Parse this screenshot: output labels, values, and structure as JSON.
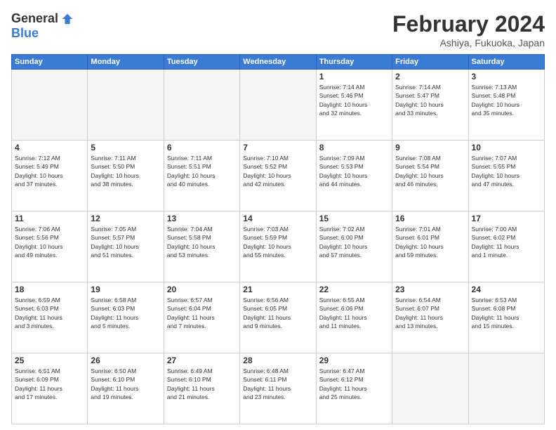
{
  "header": {
    "logo_general": "General",
    "logo_blue": "Blue",
    "month_year": "February 2024",
    "location": "Ashiya, Fukuoka, Japan"
  },
  "weekdays": [
    "Sunday",
    "Monday",
    "Tuesday",
    "Wednesday",
    "Thursday",
    "Friday",
    "Saturday"
  ],
  "weeks": [
    [
      {
        "day": "",
        "info": ""
      },
      {
        "day": "",
        "info": ""
      },
      {
        "day": "",
        "info": ""
      },
      {
        "day": "",
        "info": ""
      },
      {
        "day": "1",
        "info": "Sunrise: 7:14 AM\nSunset: 5:46 PM\nDaylight: 10 hours\nand 32 minutes."
      },
      {
        "day": "2",
        "info": "Sunrise: 7:14 AM\nSunset: 5:47 PM\nDaylight: 10 hours\nand 33 minutes."
      },
      {
        "day": "3",
        "info": "Sunrise: 7:13 AM\nSunset: 5:48 PM\nDaylight: 10 hours\nand 35 minutes."
      }
    ],
    [
      {
        "day": "4",
        "info": "Sunrise: 7:12 AM\nSunset: 5:49 PM\nDaylight: 10 hours\nand 37 minutes."
      },
      {
        "day": "5",
        "info": "Sunrise: 7:11 AM\nSunset: 5:50 PM\nDaylight: 10 hours\nand 38 minutes."
      },
      {
        "day": "6",
        "info": "Sunrise: 7:11 AM\nSunset: 5:51 PM\nDaylight: 10 hours\nand 40 minutes."
      },
      {
        "day": "7",
        "info": "Sunrise: 7:10 AM\nSunset: 5:52 PM\nDaylight: 10 hours\nand 42 minutes."
      },
      {
        "day": "8",
        "info": "Sunrise: 7:09 AM\nSunset: 5:53 PM\nDaylight: 10 hours\nand 44 minutes."
      },
      {
        "day": "9",
        "info": "Sunrise: 7:08 AM\nSunset: 5:54 PM\nDaylight: 10 hours\nand 46 minutes."
      },
      {
        "day": "10",
        "info": "Sunrise: 7:07 AM\nSunset: 5:55 PM\nDaylight: 10 hours\nand 47 minutes."
      }
    ],
    [
      {
        "day": "11",
        "info": "Sunrise: 7:06 AM\nSunset: 5:56 PM\nDaylight: 10 hours\nand 49 minutes."
      },
      {
        "day": "12",
        "info": "Sunrise: 7:05 AM\nSunset: 5:57 PM\nDaylight: 10 hours\nand 51 minutes."
      },
      {
        "day": "13",
        "info": "Sunrise: 7:04 AM\nSunset: 5:58 PM\nDaylight: 10 hours\nand 53 minutes."
      },
      {
        "day": "14",
        "info": "Sunrise: 7:03 AM\nSunset: 5:59 PM\nDaylight: 10 hours\nand 55 minutes."
      },
      {
        "day": "15",
        "info": "Sunrise: 7:02 AM\nSunset: 6:00 PM\nDaylight: 10 hours\nand 57 minutes."
      },
      {
        "day": "16",
        "info": "Sunrise: 7:01 AM\nSunset: 6:01 PM\nDaylight: 10 hours\nand 59 minutes."
      },
      {
        "day": "17",
        "info": "Sunrise: 7:00 AM\nSunset: 6:02 PM\nDaylight: 11 hours\nand 1 minute."
      }
    ],
    [
      {
        "day": "18",
        "info": "Sunrise: 6:59 AM\nSunset: 6:03 PM\nDaylight: 11 hours\nand 3 minutes."
      },
      {
        "day": "19",
        "info": "Sunrise: 6:58 AM\nSunset: 6:03 PM\nDaylight: 11 hours\nand 5 minutes."
      },
      {
        "day": "20",
        "info": "Sunrise: 6:57 AM\nSunset: 6:04 PM\nDaylight: 11 hours\nand 7 minutes."
      },
      {
        "day": "21",
        "info": "Sunrise: 6:56 AM\nSunset: 6:05 PM\nDaylight: 11 hours\nand 9 minutes."
      },
      {
        "day": "22",
        "info": "Sunrise: 6:55 AM\nSunset: 6:06 PM\nDaylight: 11 hours\nand 11 minutes."
      },
      {
        "day": "23",
        "info": "Sunrise: 6:54 AM\nSunset: 6:07 PM\nDaylight: 11 hours\nand 13 minutes."
      },
      {
        "day": "24",
        "info": "Sunrise: 6:53 AM\nSunset: 6:08 PM\nDaylight: 11 hours\nand 15 minutes."
      }
    ],
    [
      {
        "day": "25",
        "info": "Sunrise: 6:51 AM\nSunset: 6:09 PM\nDaylight: 11 hours\nand 17 minutes."
      },
      {
        "day": "26",
        "info": "Sunrise: 6:50 AM\nSunset: 6:10 PM\nDaylight: 11 hours\nand 19 minutes."
      },
      {
        "day": "27",
        "info": "Sunrise: 6:49 AM\nSunset: 6:10 PM\nDaylight: 11 hours\nand 21 minutes."
      },
      {
        "day": "28",
        "info": "Sunrise: 6:48 AM\nSunset: 6:11 PM\nDaylight: 11 hours\nand 23 minutes."
      },
      {
        "day": "29",
        "info": "Sunrise: 6:47 AM\nSunset: 6:12 PM\nDaylight: 11 hours\nand 25 minutes."
      },
      {
        "day": "",
        "info": ""
      },
      {
        "day": "",
        "info": ""
      }
    ]
  ]
}
